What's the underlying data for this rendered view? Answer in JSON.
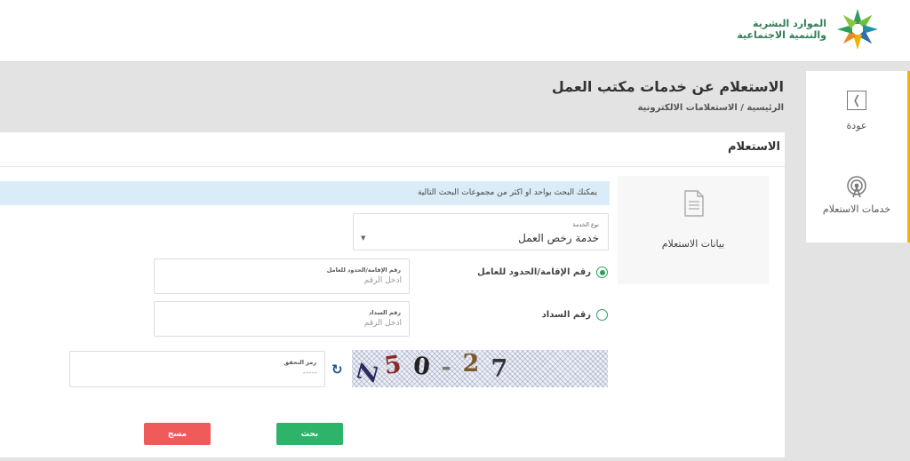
{
  "header": {
    "logo_line1": "الموارد البشرية",
    "logo_line2": "والتنمية الاجتماعية"
  },
  "page": {
    "title": "الاستعلام عن خدمات مكتب العمل",
    "breadcrumb": "الرئيسية / الاستعلامات الالكترونية"
  },
  "side_menu": {
    "back_label": "عودة",
    "services_label": "خدمات الاستعلام"
  },
  "form": {
    "card_title": "الاستعلام",
    "section_label": "بيانات الاستعلام",
    "info_text": "يمكنك البحث بواحد او اكثر من مجموعات البحث التالية",
    "service_type": {
      "label": "نوع الخدمة",
      "value": "خدمة رخص العمل"
    },
    "options": [
      {
        "label": "رقم الإقامة/الحدود للعامل",
        "selected": true
      },
      {
        "label": "رقم السداد",
        "selected": false
      }
    ],
    "iqama_field": {
      "label": "رقم الإقامة/الحدود للعامل",
      "placeholder": "أدخل الرقم"
    },
    "sadad_field": {
      "label": "رقم السداد",
      "placeholder": "أدخل الرقم"
    },
    "captcha_field": {
      "label": "رمز التحقق",
      "placeholder": "-----"
    },
    "captcha_text": "Z50-27",
    "search_button": "بحث",
    "clear_button": "مسح"
  },
  "colors": {
    "accent_green": "#2eb36a",
    "danger_red": "#ef5b5b",
    "side_accent": "#f0b400",
    "info_blue": "#d9ecf8"
  }
}
